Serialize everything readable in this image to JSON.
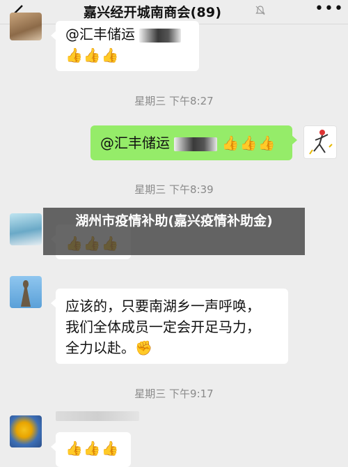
{
  "header": {
    "title": "嘉兴经开城南商会(89)",
    "back_icon": "back-chevron-icon",
    "mute_icon": "bell-muted-icon",
    "more_icon": "more-dots-icon",
    "more_glyph": "•••"
  },
  "messages": [
    {
      "side": "left",
      "text": "@汇丰储运",
      "reaction": "👍👍👍"
    },
    {
      "type": "timestamp",
      "text": "星期三 下午8:27"
    },
    {
      "side": "right",
      "text": "@汇丰储运",
      "reaction": "👍👍👍"
    },
    {
      "type": "timestamp",
      "text": "星期三 下午8:39"
    },
    {
      "side": "left",
      "reaction": "👍👍👍"
    },
    {
      "side": "left",
      "lines": [
        "应该的，只要南湖乡一声呼唤，",
        "我们全体成员一定会开足马力，",
        "全力以赴。✊"
      ]
    },
    {
      "type": "timestamp",
      "text": "星期三 下午9:17"
    },
    {
      "side": "left",
      "reaction": "👍👍👍"
    }
  ],
  "overlay_caption": "湖州市疫情补助(嘉兴疫情补助金)",
  "colors": {
    "background": "#ededed",
    "my_bubble": "#95ec69",
    "other_bubble": "#ffffff",
    "timestamp": "#8a8a8a"
  }
}
